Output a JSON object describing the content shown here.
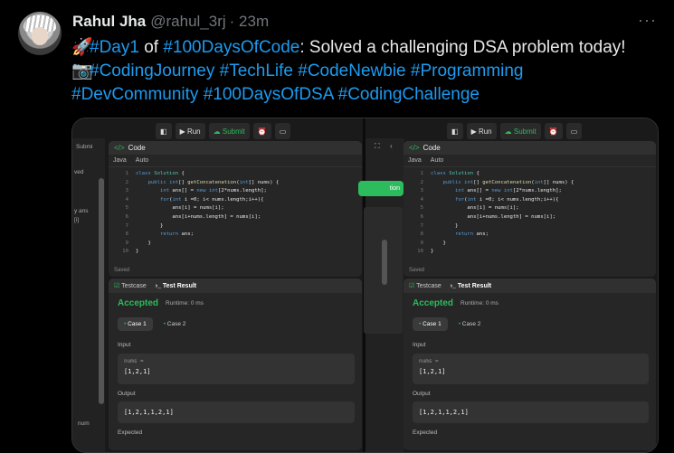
{
  "post": {
    "author_name": "Rahul Jha",
    "handle": "@rahul_3rj",
    "time": "· 23m",
    "more_glyph": "···",
    "line1_emoji": "🚀",
    "line1_tag1": "#Day1",
    "line1_of": " of ",
    "line1_tag2": "#100DaysOfCode",
    "line1_text": ": Solved a challenging DSA problem today!",
    "line2_emoji": "📷",
    "line2_tags": "#CodingJourney #TechLife #CodeNewbie #Programming",
    "line3_tags": "#DevCommunity #100DaysOfDSA #CodingChallenge"
  },
  "editor": {
    "run_label": "Run",
    "submit_label": "Submit",
    "code_tab": "Code",
    "language": "Java",
    "auto_label": "Auto",
    "saved_label": "Saved",
    "testcase_tab": "Testcase",
    "test_result_tab": "Test Result",
    "status": "Accepted",
    "runtime": "Runtime: 0 ms",
    "case1": "Case 1",
    "case2": "Case 2",
    "input_label": "Input",
    "input_var": "nums =",
    "input_value": "[1,2,1]",
    "output_label": "Output",
    "output_value": "[1,2,1,1,2,1]",
    "expected_label": "Expected",
    "left_strip_submit": "Submi",
    "left_strip_solved": "ved",
    "left_strip_ans": "y ans",
    "left_strip_i": "[i]",
    "left_strip_num": "num",
    "mid_btn": "tion",
    "code_lines": [
      "class Solution {",
      "    public int[] getConcatenation(int[] nums) {",
      "        int ans[] = new int[2*nums.length];",
      "        for(int i =0; i< nums.length;i++){",
      "            ans[i] = nums[i];",
      "            ans[i+nums.length] = nums[i];",
      "        }",
      "        return ans;",
      "    }",
      "}"
    ]
  },
  "colors": {
    "accent_blue": "#1d9bf0",
    "accepted_green": "#2cbb5d"
  }
}
